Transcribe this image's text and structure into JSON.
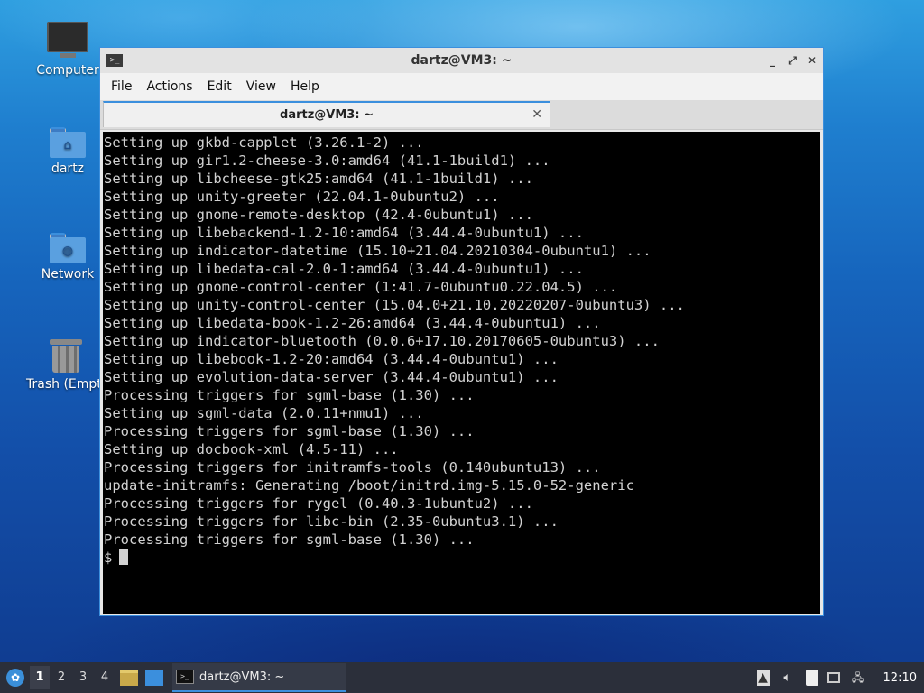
{
  "desktop": {
    "icons": [
      {
        "label": "Computer",
        "icon": "computer-icon"
      },
      {
        "label": "dartz",
        "icon": "home-folder-icon"
      },
      {
        "label": "Network",
        "icon": "network-folder-icon"
      },
      {
        "label": "Trash (Empt",
        "icon": "trash-icon"
      }
    ]
  },
  "window": {
    "title": "dartz@VM3: ~",
    "menu": [
      "File",
      "Actions",
      "Edit",
      "View",
      "Help"
    ],
    "tab_label": "dartz@VM3: ~",
    "buttons": {
      "minimize": "_",
      "maximize": "⤢",
      "close": "✕",
      "tab_close": "✕"
    }
  },
  "terminal": {
    "lines": [
      "Setting up gkbd-capplet (3.26.1-2) ...",
      "Setting up gir1.2-cheese-3.0:amd64 (41.1-1build1) ...",
      "Setting up libcheese-gtk25:amd64 (41.1-1build1) ...",
      "Setting up unity-greeter (22.04.1-0ubuntu2) ...",
      "Setting up gnome-remote-desktop (42.4-0ubuntu1) ...",
      "Setting up libebackend-1.2-10:amd64 (3.44.4-0ubuntu1) ...",
      "Setting up indicator-datetime (15.10+21.04.20210304-0ubuntu1) ...",
      "Setting up libedata-cal-2.0-1:amd64 (3.44.4-0ubuntu1) ...",
      "Setting up gnome-control-center (1:41.7-0ubuntu0.22.04.5) ...",
      "Setting up unity-control-center (15.04.0+21.10.20220207-0ubuntu3) ...",
      "Setting up libedata-book-1.2-26:amd64 (3.44.4-0ubuntu1) ...",
      "Setting up indicator-bluetooth (0.0.6+17.10.20170605-0ubuntu3) ...",
      "Setting up libebook-1.2-20:amd64 (3.44.4-0ubuntu1) ...",
      "Setting up evolution-data-server (3.44.4-0ubuntu1) ...",
      "Processing triggers for sgml-base (1.30) ...",
      "Setting up sgml-data (2.0.11+nmu1) ...",
      "Processing triggers for sgml-base (1.30) ...",
      "Setting up docbook-xml (4.5-11) ...",
      "Processing triggers for initramfs-tools (0.140ubuntu13) ...",
      "update-initramfs: Generating /boot/initrd.img-5.15.0-52-generic",
      "Processing triggers for rygel (0.40.3-1ubuntu2) ...",
      "Processing triggers for libc-bin (2.35-0ubuntu3.1) ...",
      "Processing triggers for sgml-base (1.30) ..."
    ],
    "prompt": "$"
  },
  "taskbar": {
    "workspaces": [
      "1",
      "2",
      "3",
      "4"
    ],
    "active_workspace": "1",
    "task_label": "dartz@VM3: ~",
    "clock": "12:10"
  }
}
